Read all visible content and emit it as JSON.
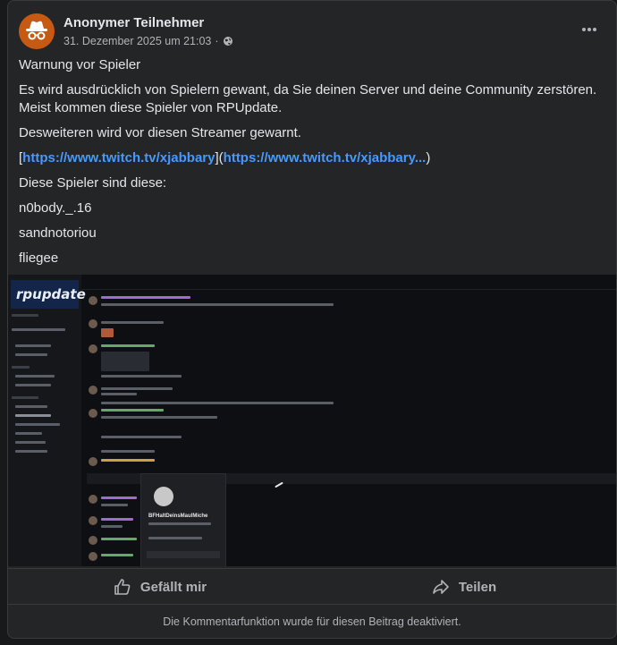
{
  "post": {
    "author": "Anonymer Teilnehmer",
    "date": "31. Dezember 2025 um 21:03",
    "separator": "·",
    "privacy_icon": "globe-icon",
    "avatar_icon": "incognito-icon",
    "more_icon": "more-dots-icon",
    "lines": {
      "title": "Warnung vor Spieler",
      "p1": "Es wird ausdrücklich von Spielern gewant, da Sie deinen Server und deine Community zerstören. Meist kommen diese Spieler von RPUpdate.",
      "p2": "Desweiteren wird vor diesen Streamer gewarnt.",
      "bracket_open": "[",
      "link1": "https://www.twitch.tv/xjabbary",
      "bracket_mid": "](",
      "link2": "https://www.twitch.tv/xjabbary...",
      "bracket_close": ")",
      "p4": "Diese Spieler sind diese:",
      "player1": "n0body._.16",
      "player2": "sandnotoriou",
      "player3": "fliegee"
    }
  },
  "screenshot": {
    "banner_text": "rpupdate",
    "popup_name": "BFHaltDeinsMaulMiche"
  },
  "actions": {
    "like_label": "Gefällt mir",
    "like_icon": "thumbs-up-icon",
    "share_label": "Teilen",
    "share_icon": "share-icon"
  },
  "footer": {
    "text": "Die Kommentarfunktion wurde für diesen Beitrag deaktiviert."
  },
  "colors": {
    "background": "#18191a",
    "card": "#242526",
    "link": "#4599ff",
    "avatar": "#c65a12"
  }
}
